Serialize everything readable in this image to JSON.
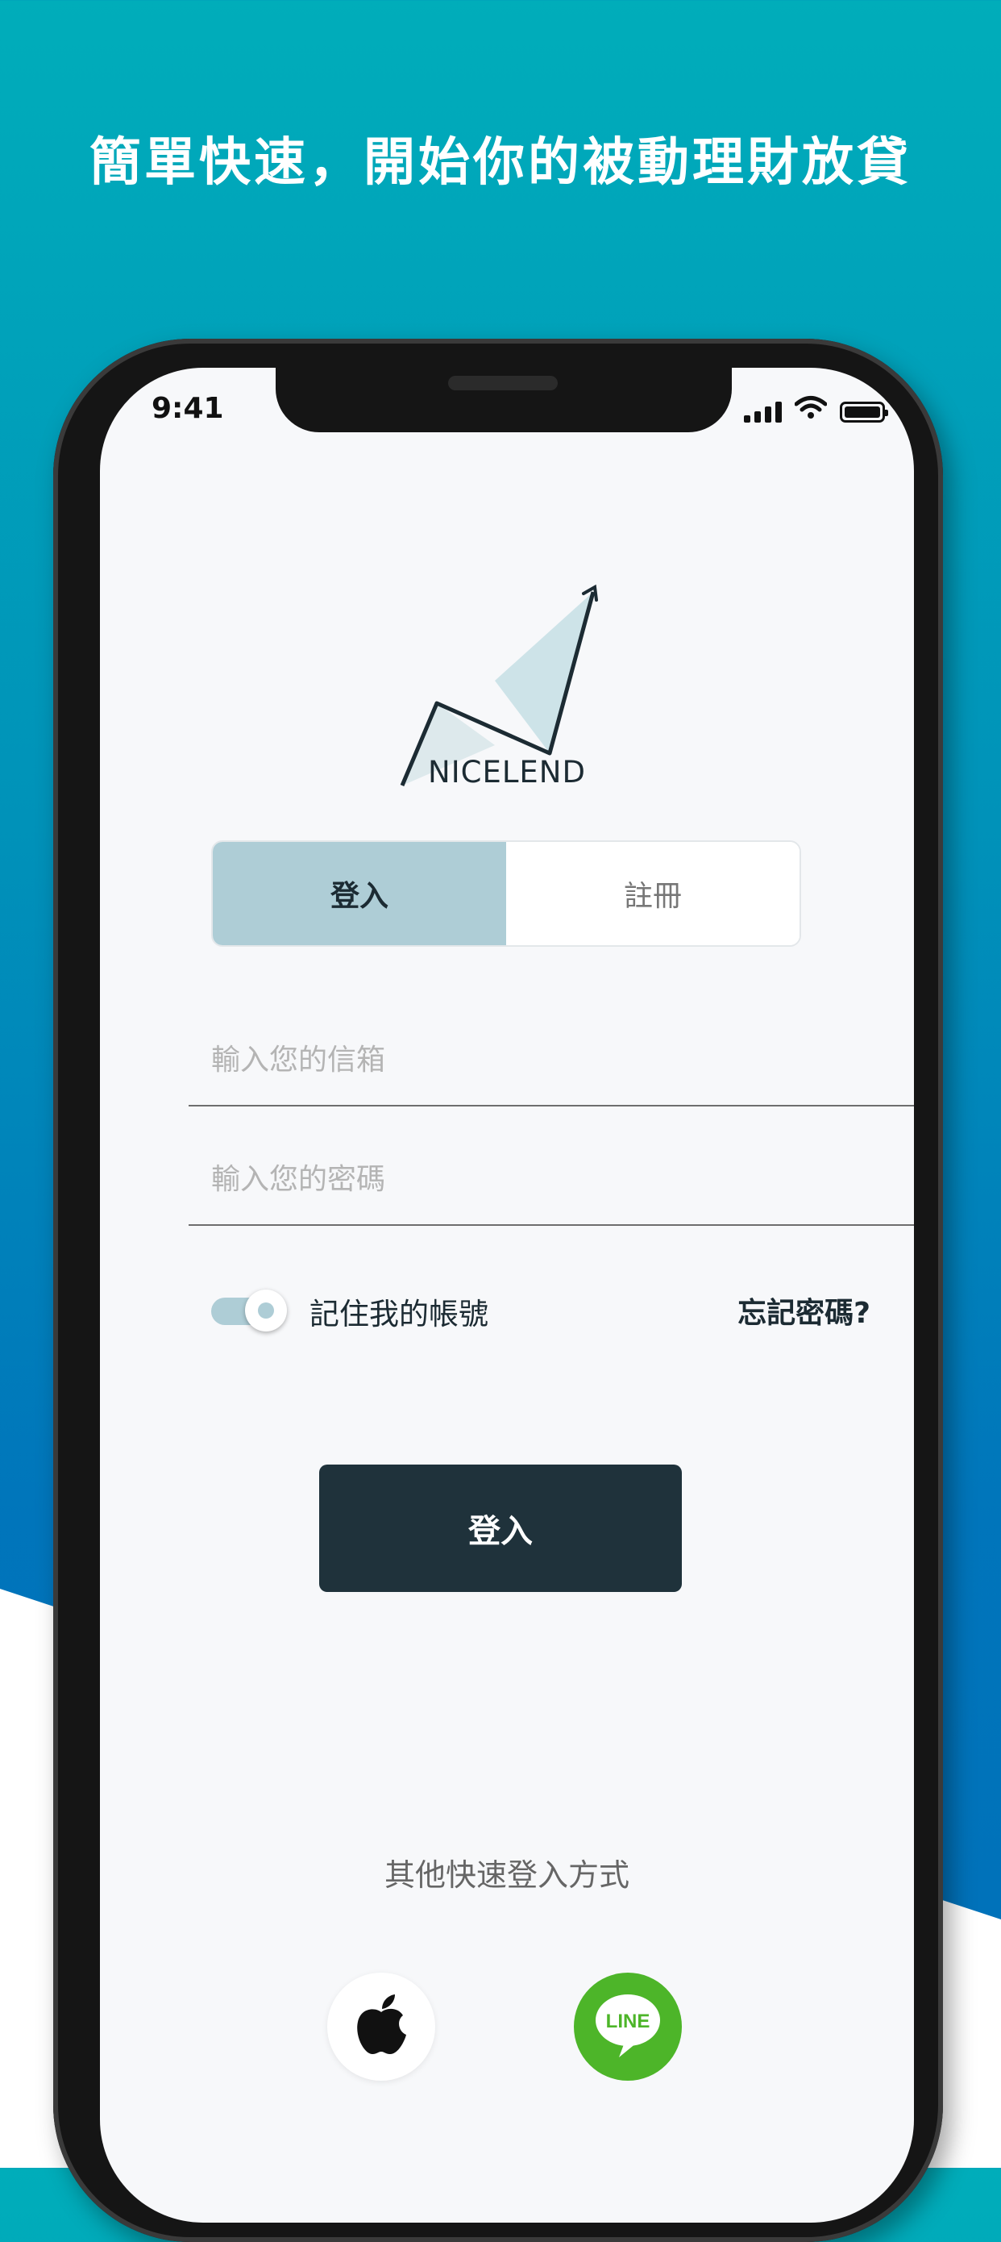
{
  "headline": "簡單快速，開始你的被動理財放貸",
  "status_bar": {
    "time": "9:41"
  },
  "brand": {
    "name": "NICELEND"
  },
  "tabs": [
    {
      "label": "登入",
      "active": true
    },
    {
      "label": "註冊",
      "active": false
    }
  ],
  "email_field": {
    "placeholder": "輸入您的信箱",
    "value": ""
  },
  "password_field": {
    "placeholder": "輸入您的密碼",
    "value": ""
  },
  "remember": {
    "label": "記住我的帳號",
    "on": true
  },
  "forgot_password": "忘記密碼?",
  "login_button": "登入",
  "other_login": {
    "label": "其他快速登入方式",
    "providers": [
      "apple-icon",
      "line-icon"
    ],
    "line_text": "LINE"
  },
  "colors": {
    "accent": "#aecdd6",
    "primary_button": "#1f323b",
    "line_green": "#4db529",
    "bg_top": "#00adba",
    "bg_bottom": "#0070b9"
  }
}
